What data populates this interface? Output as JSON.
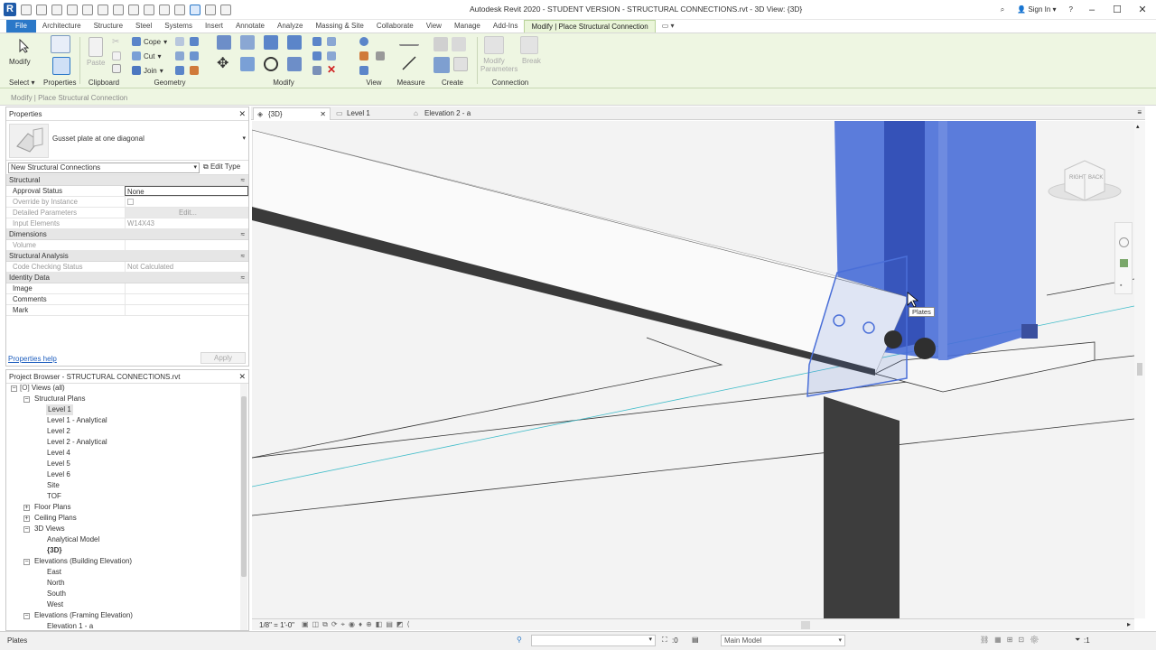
{
  "app": {
    "title": "Autodesk Revit 2020 - STUDENT VERSION - STRUCTURAL CONNECTIONS.rvt - 3D View: {3D}",
    "sign_in": "Sign In"
  },
  "ribbon_tabs": [
    "File",
    "Architecture",
    "Structure",
    "Steel",
    "Systems",
    "Insert",
    "Annotate",
    "Analyze",
    "Massing & Site",
    "Collaborate",
    "View",
    "Manage",
    "Add-Ins",
    "Modify | Place Structural Connection"
  ],
  "ribbon": {
    "modify_label": "Modify",
    "select_label": "Select ▾",
    "properties_label": "Properties",
    "paste_label": "Paste",
    "clipboard_label": "Clipboard",
    "cope_label": "Cope",
    "cut_label": "Cut",
    "join_label": "Join",
    "geometry_label": "Geometry",
    "modify_group_label": "Modify",
    "view_label": "View",
    "measure_label": "Measure",
    "create_label": "Create",
    "modify_parameters_label": "Modify Parameters",
    "break_label": "Break",
    "connection_label": "Connection"
  },
  "options_bar": {
    "text": "Modify | Place Structural Connection"
  },
  "properties": {
    "title": "Properties",
    "type_name": "Gusset plate at one diagonal",
    "filter": "New Structural Connections",
    "edit_type": "Edit Type",
    "categories": [
      {
        "name": "Structural",
        "rows": [
          {
            "label": "Approval Status",
            "value": "None"
          },
          {
            "label": "Override by Instance",
            "value": ""
          },
          {
            "label": "Detailed Parameters",
            "value": "Edit..."
          },
          {
            "label": "Input Elements",
            "value": "W14X43"
          }
        ]
      },
      {
        "name": "Dimensions",
        "rows": [
          {
            "label": "Volume",
            "value": ""
          }
        ]
      },
      {
        "name": "Structural Analysis",
        "rows": [
          {
            "label": "Code Checking Status",
            "value": "Not Calculated"
          }
        ]
      },
      {
        "name": "Identity Data",
        "rows": [
          {
            "label": "Image",
            "value": ""
          },
          {
            "label": "Comments",
            "value": ""
          },
          {
            "label": "Mark",
            "value": ""
          }
        ]
      }
    ],
    "help": "Properties help",
    "apply": "Apply"
  },
  "project_browser": {
    "title": "Project Browser - STRUCTURAL CONNECTIONS.rvt",
    "nodes": [
      "Views (all)",
      "Structural Plans",
      "Level 1",
      "Level 1 - Analytical",
      "Level 2",
      "Level 2 - Analytical",
      "Level 4",
      "Level 5",
      "Level 6",
      "Site",
      "TOF",
      "Floor Plans",
      "Ceiling Plans",
      "3D Views",
      "Analytical Model",
      "{3D}",
      "Elevations (Building Elevation)",
      "East",
      "North",
      "South",
      "West",
      "Elevations (Framing Elevation)",
      "Elevation 1 - a"
    ]
  },
  "view_tabs": [
    "{3D}",
    "Level 1",
    "Elevation 2 - a"
  ],
  "viewcube": {
    "right": "RIGHT",
    "back": "BACK"
  },
  "tooltip": "Plates",
  "view_bar": {
    "scale": "1/8\" = 1'-0\""
  },
  "status": {
    "text": "Plates",
    "zero": ":0",
    "model": "Main Model",
    "filter_count": ":1"
  },
  "colors": {
    "accent": "#2b78c8",
    "ribbon_bg": "#eef6e2",
    "selection_blue": "#4a6fd8"
  }
}
